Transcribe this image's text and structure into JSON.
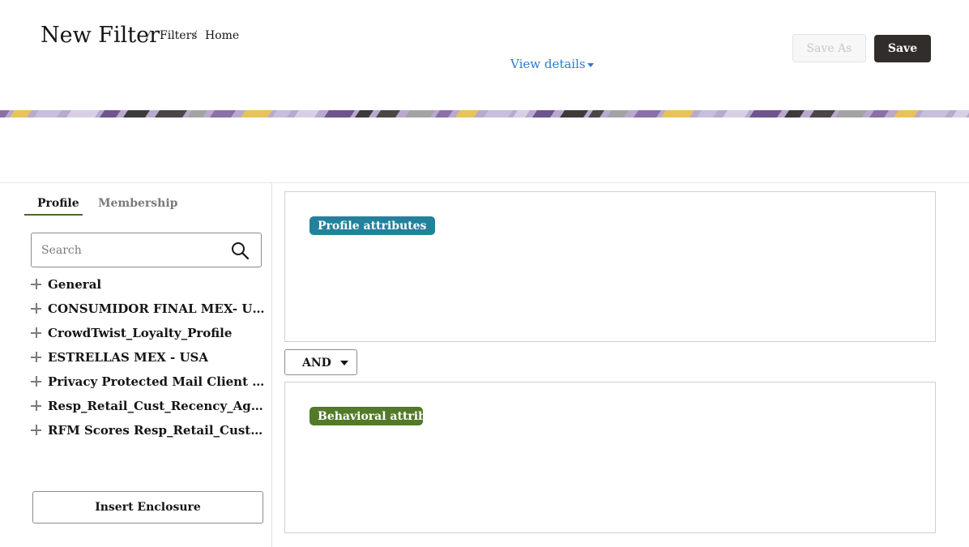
{
  "header": {
    "title": "New Filter",
    "breadcrumbs": [
      "Filters",
      "Home"
    ],
    "breadcrumb_separator": "/",
    "view_details_label": "View details",
    "save_as_label": "Save As",
    "save_label": "Save"
  },
  "sidebar": {
    "tabs": [
      {
        "label": "Profile",
        "active": true
      },
      {
        "label": "Membership",
        "active": false
      }
    ],
    "search": {
      "placeholder": "Search",
      "value": ""
    },
    "tree_items": [
      {
        "label": "General"
      },
      {
        "label": "CONSUMIDOR FINAL MEX- USA"
      },
      {
        "label": "CrowdTwist_Loyalty_Profile"
      },
      {
        "label": "ESTRELLAS MEX - USA"
      },
      {
        "label": "Privacy Protected Mail Client Resp_..."
      },
      {
        "label": "Resp_Retail_Cust_Recency_Aggregate"
      },
      {
        "label": "RFM Scores Resp_Retail_Customers"
      }
    ],
    "insert_enclosure_label": "Insert Enclosure"
  },
  "main": {
    "profile_attributes_label": "Profile attributes",
    "operator": {
      "value": "AND",
      "options": [
        "AND"
      ]
    },
    "behavioral_attributes_label": "Behavioral attributes"
  },
  "colors": {
    "accent_link": "#2b7bd4",
    "primary_button": "#312d2a",
    "profile_chip": "#23819c",
    "behavioral_chip": "#527a28",
    "tab_underline": "#4a6b2e"
  }
}
